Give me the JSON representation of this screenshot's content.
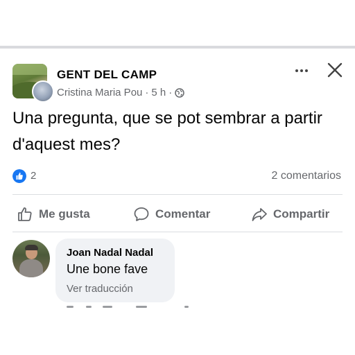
{
  "post": {
    "group_name": "GENT  DEL CAMP",
    "author": "Cristina Maria Pou",
    "time": "5 h",
    "separator": "·",
    "text": "Una pregunta, que se pot sembrar a partir d'aquest mes?"
  },
  "reactions": {
    "count": "2",
    "comments_label": "2 comentarios"
  },
  "actions": {
    "like": "Me gusta",
    "comment": "Comentar",
    "share": "Compartir"
  },
  "comment": {
    "author": "Joan Nadal Nadal",
    "text": "Une bone fave",
    "translate": "Ver traducción"
  },
  "icons": {
    "more": "more-options-icon",
    "close": "close-icon",
    "globe": "globe-icon",
    "like": "thumbs-up-icon",
    "comment": "speech-bubble-icon",
    "share": "share-arrow-icon"
  },
  "colors": {
    "accent": "#1877f2",
    "secondary_text": "#65676b",
    "bubble": "#f0f2f5"
  }
}
